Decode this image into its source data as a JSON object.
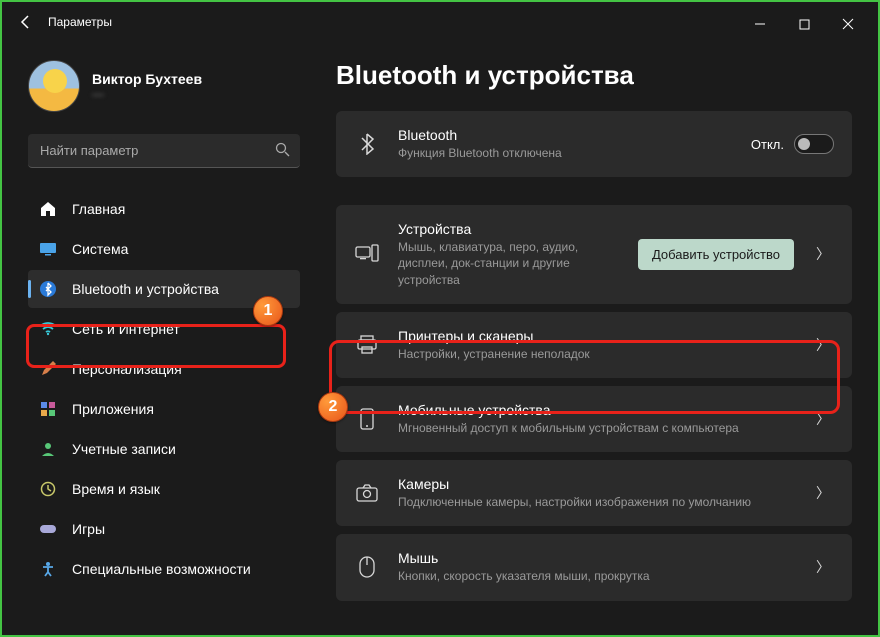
{
  "titlebar": {
    "title": "Параметры"
  },
  "user": {
    "name": "Виктор Бухтеев",
    "sub": "—"
  },
  "search": {
    "placeholder": "Найти параметр"
  },
  "sidebar": {
    "items": [
      {
        "label": "Главная"
      },
      {
        "label": "Система"
      },
      {
        "label": "Bluetooth и устройства"
      },
      {
        "label": "Сеть и Интернет"
      },
      {
        "label": "Персонализация"
      },
      {
        "label": "Приложения"
      },
      {
        "label": "Учетные записи"
      },
      {
        "label": "Время и язык"
      },
      {
        "label": "Игры"
      },
      {
        "label": "Специальные возможности"
      }
    ]
  },
  "main": {
    "title": "Bluetooth и устройства",
    "bluetooth": {
      "title": "Bluetooth",
      "sub": "Функция Bluetooth отключена",
      "state": "Откл."
    },
    "devices": {
      "title": "Устройства",
      "sub": "Мышь, клавиатура, перо, аудио, дисплеи, док-станции и другие устройства",
      "btn": "Добавить устройство"
    },
    "printers": {
      "title": "Принтеры и сканеры",
      "sub": "Настройки, устранение неполадок"
    },
    "mobile": {
      "title": "Мобильные устройства",
      "sub": "Мгновенный доступ к мобильным устройствам с компьютера"
    },
    "cameras": {
      "title": "Камеры",
      "sub": "Подключенные камеры, настройки изображения по умолчанию"
    },
    "mouse": {
      "title": "Мышь",
      "sub": "Кнопки, скорость указателя мыши, прокрутка"
    }
  },
  "annotations": {
    "badge1": "1",
    "badge2": "2"
  }
}
